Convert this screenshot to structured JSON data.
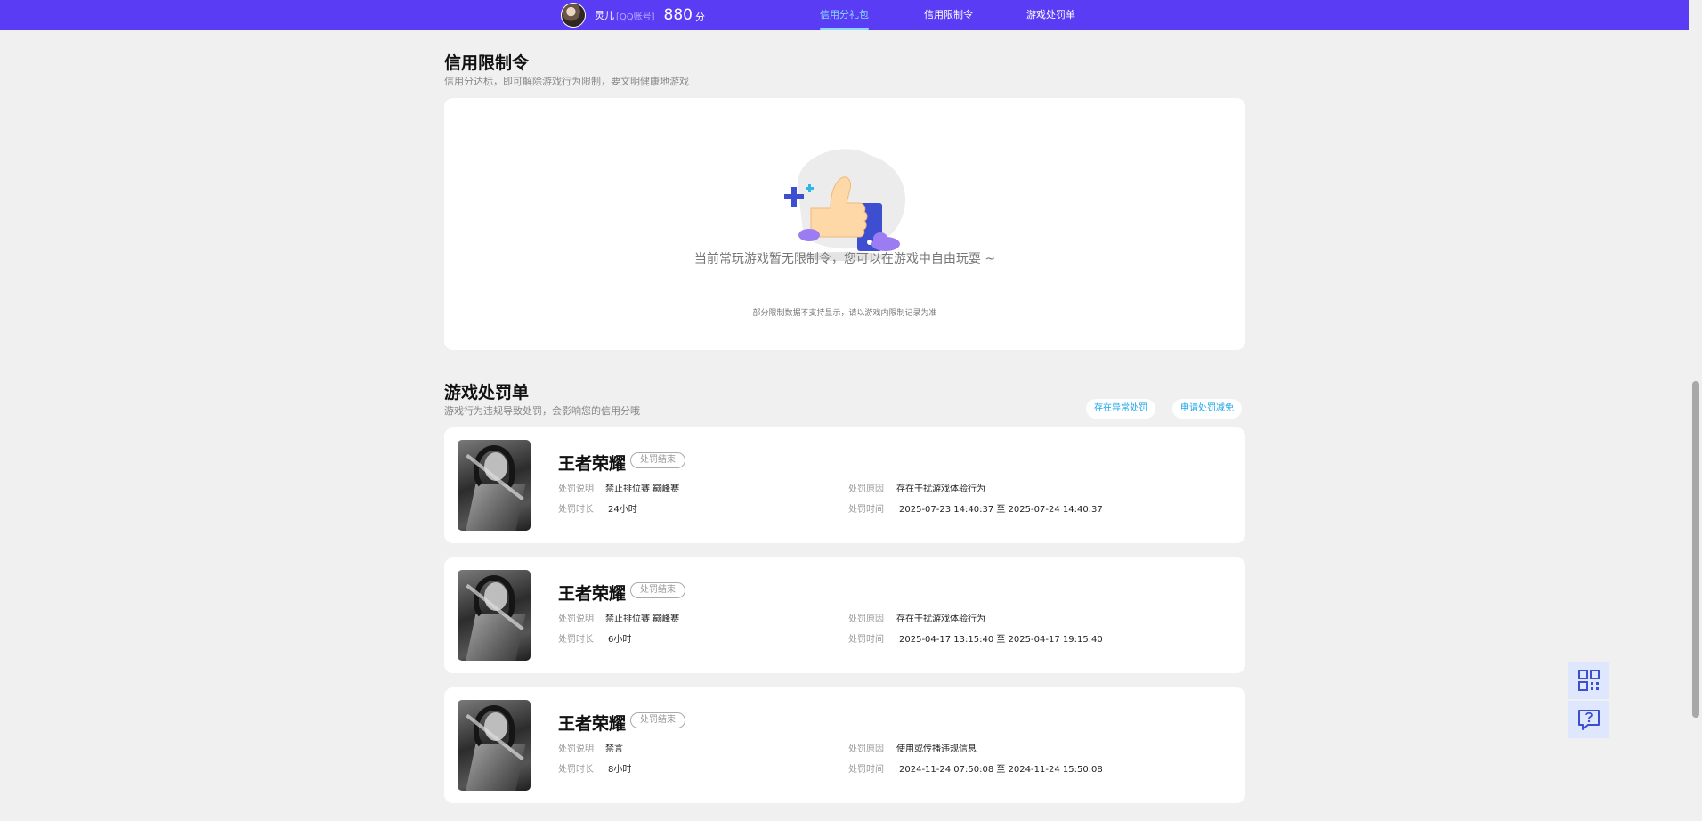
{
  "header": {
    "username": "灵儿",
    "account_type": "[QQ账号]",
    "score": "880",
    "score_unit": "分",
    "tabs": [
      {
        "label": "信用分礼包",
        "active": true
      },
      {
        "label": "信用限制令",
        "active": false
      },
      {
        "label": "游戏处罚单",
        "active": false
      }
    ]
  },
  "restriction": {
    "title": "信用限制令",
    "subtitle": "信用分达标，即可解除游戏行为限制，要文明健康地游戏",
    "empty_message": "当前常玩游戏暂无限制令，您可以在游戏中自由玩耍 ~",
    "empty_note": "部分限制数据不支持显示，请以游戏内限制记录为准"
  },
  "punishments": {
    "title": "游戏处罚单",
    "subtitle": "游戏行为违规导致处罚，会影响您的信用分哦",
    "actions": {
      "abnormal": "存在异常处罚",
      "appeal": "申请处罚减免"
    },
    "labels": {
      "desc": "处罚说明",
      "duration": "处罚时长",
      "reason": "处罚原因",
      "time": "处罚时间"
    },
    "items": [
      {
        "game": "王者荣耀",
        "status": "处罚结束",
        "desc": "禁止排位赛 巅峰赛",
        "duration": "24小时",
        "reason": "存在干扰游戏体验行为",
        "time": "2025-07-23 14:40:37 至 2025-07-24 14:40:37"
      },
      {
        "game": "王者荣耀",
        "status": "处罚结束",
        "desc": "禁止排位赛 巅峰赛",
        "duration": "6小时",
        "reason": "存在干扰游戏体验行为",
        "time": "2025-04-17 13:15:40 至 2025-04-17 19:15:40"
      },
      {
        "game": "王者荣耀",
        "status": "处罚结束",
        "desc": "禁言",
        "duration": "8小时",
        "reason": "使用或传播违规信息",
        "time": "2024-11-24 07:50:08 至 2024-11-24 15:50:08"
      }
    ]
  },
  "side_tools": {
    "icons": [
      "qr-code-icon",
      "help-chat-icon"
    ]
  },
  "colors": {
    "brand": "#5a3cf5",
    "accent": "#1ba5e8",
    "active_tab": "#8ad6ff"
  }
}
